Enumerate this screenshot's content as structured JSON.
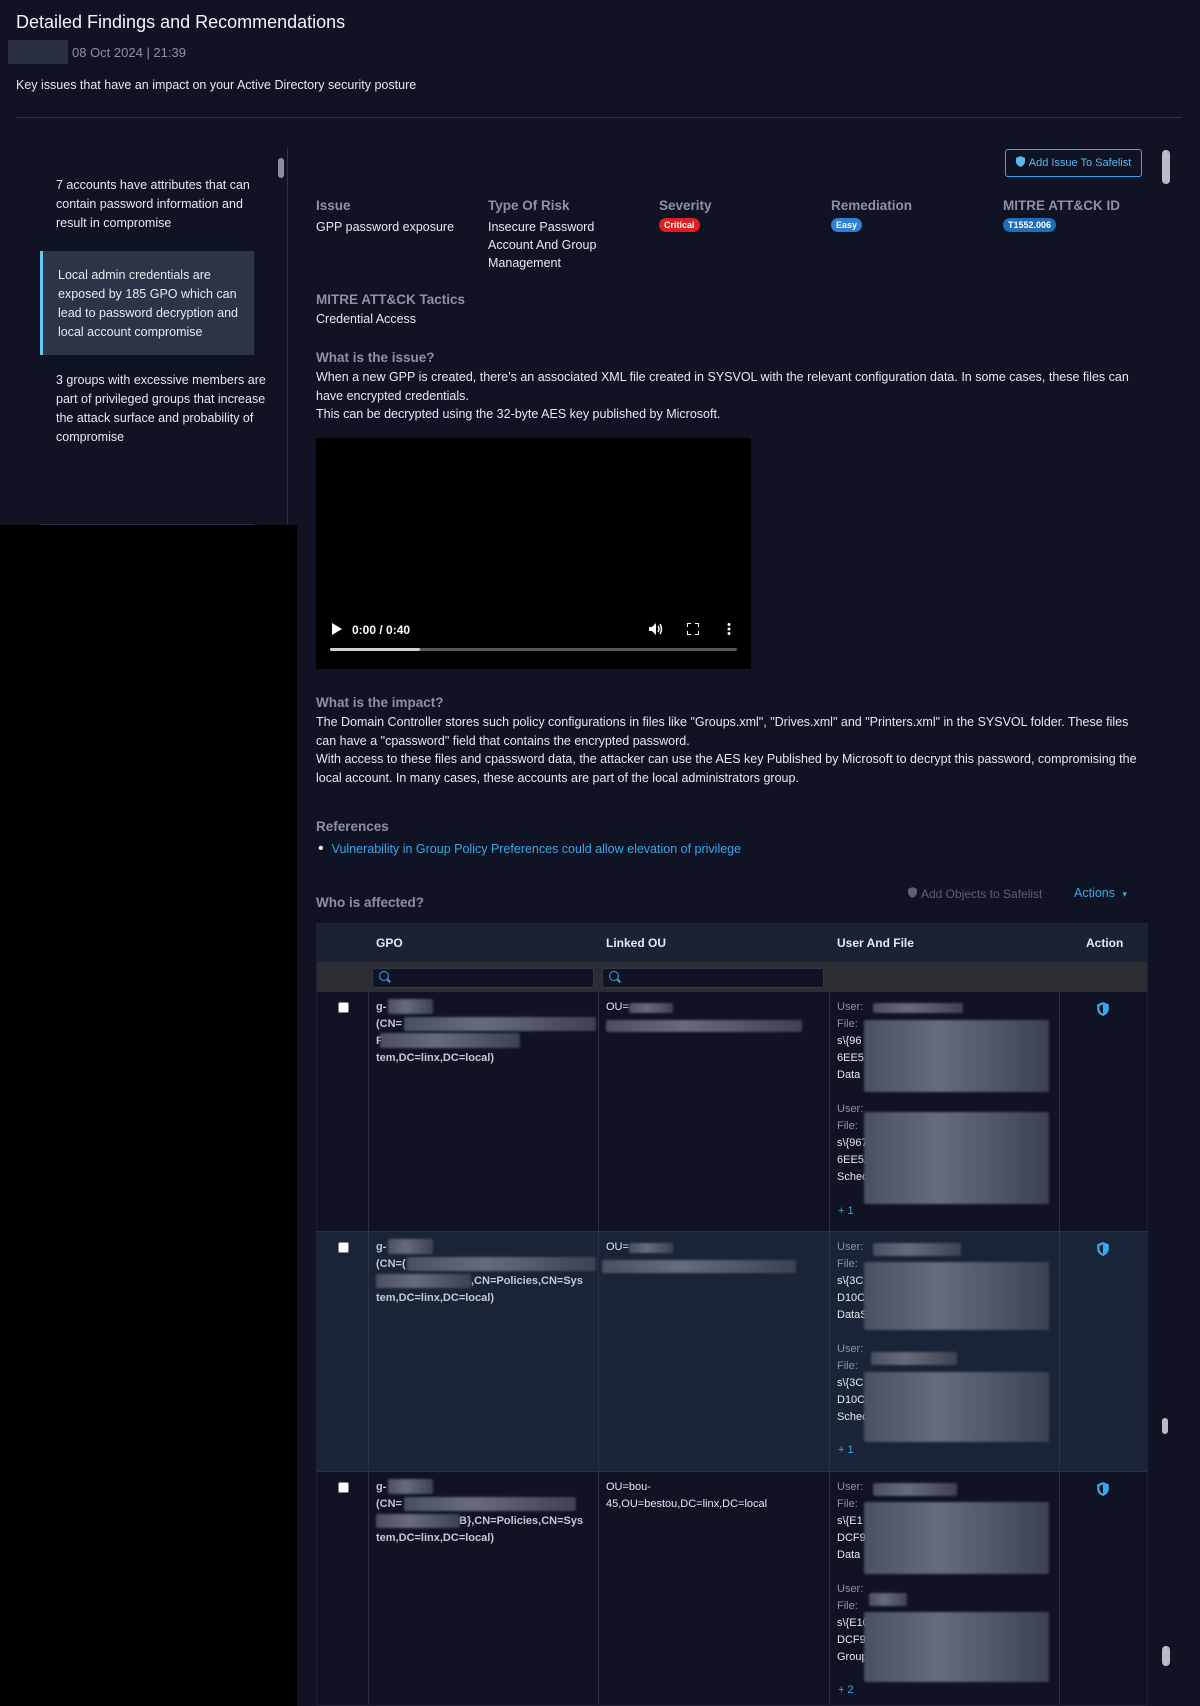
{
  "header": {
    "title": "Detailed Findings and Recommendations",
    "timestamp": "08 Oct 2024 | 21:39",
    "subtitle": "Key issues that have an impact on your Active Directory security posture"
  },
  "sidebar": {
    "items": [
      {
        "label": "7 accounts have attributes that can contain password information and result in compromise",
        "active": false
      },
      {
        "label": "Local admin credentials are exposed by 185 GPO which can lead to password decryption and local account compromise",
        "active": true
      },
      {
        "label": "3 groups with excessive members are part of privileged groups that increase the attack surface and probability of compromise",
        "active": false
      }
    ]
  },
  "add_issue_button": "Add Issue To Safelist",
  "issue": {
    "issue_label": "Issue",
    "issue_value": "GPP password exposure",
    "risk_label": "Type Of Risk",
    "risk_value": "Insecure Password Account And Group Management",
    "severity_label": "Severity",
    "severity_value": "Critical",
    "remediation_label": "Remediation",
    "remediation_value": "Easy",
    "mitre_id_label": "MITRE ATT&CK ID",
    "mitre_id_value": "T1552.006",
    "tactics_label": "MITRE ATT&CK Tactics",
    "tactics_value": "Credential Access"
  },
  "what_is_issue": {
    "title": "What is the issue?",
    "p1": "When a new GPP is created, there's an associated XML file created in SYSVOL with the relevant configuration data. In some cases, these files can have encrypted credentials.",
    "p2": "This can be decrypted using the 32-byte AES key published by Microsoft."
  },
  "video": {
    "time": "0:00 / 0:40",
    "progress": 0.22
  },
  "what_is_impact": {
    "title": "What is the impact?",
    "p1": "The Domain Controller stores such policy configurations in files like \"Groups.xml\", \"Drives.xml\" and \"Printers.xml\" in the SYSVOL folder. These files can have a \"cpassword\" field that contains the encrypted password.",
    "p2": "With access to these files and cpassword data, the attacker can use the AES key Published by Microsoft to decrypt this password, compromising the local account. In many cases, these accounts are part of the local administrators group."
  },
  "references": {
    "title": "References",
    "links": [
      "Vulnerability in Group Policy Preferences could allow elevation of privilege"
    ]
  },
  "affected": {
    "title": "Who is affected?",
    "add_objects": "Add Objects to Safelist",
    "actions": "Actions",
    "columns": {
      "gpo": "GPO",
      "linked_ou": "Linked OU",
      "user_file": "User And File",
      "action": "Action"
    },
    "rows": [
      {
        "gpo_line1": "g-",
        "gpo_line2": "(CN=",
        "gpo_line3": "F},CN=Policies,CN=Sys",
        "gpo_line4": "tem,DC=linx,DC=local)",
        "ou": "OU=",
        "ou2": "",
        "u1_user": "User:",
        "u1_file": "File:",
        "u1_f1": "s\\{96",
        "u1_f2": "6EE5",
        "u1_f3": "Data",
        "u2_user": "User:",
        "u2_file": "File:",
        "u2_f1": "s\\{967",
        "u2_f2": "6EE52",
        "u2_f3": "Schec",
        "more": "+ 1"
      },
      {
        "gpo_line1": "g-",
        "gpo_line2": "(CN=(",
        "gpo_line3": ",CN=Policies,CN=Sys",
        "gpo_line4": "tem,DC=linx,DC=local)",
        "ou": "OU=",
        "ou2": "",
        "u1_user": "User:",
        "u1_file": "File:",
        "u1_f1": "s\\{3C",
        "u1_f2": "D10C",
        "u1_f3": "DataS",
        "u2_user": "User:",
        "u2_file": "File:",
        "u2_f1": "s\\{3C",
        "u2_f2": "D10C",
        "u2_f3": "Schec",
        "more": "+ 1"
      },
      {
        "gpo_line1": "g-",
        "gpo_line2": "(CN=",
        "gpo_line3": "B},CN=Policies,CN=Sys",
        "gpo_line4": "tem,DC=linx,DC=local)",
        "ou": "OU=bou-",
        "ou2": "45,OU=bestou,DC=linx,DC=local",
        "u1_user": "User:",
        "u1_file": "File:",
        "u1_f1": "s\\{E1",
        "u1_f2": "DCF9",
        "u1_f3": "Data",
        "u2_user": "User:",
        "u2_file": "File:",
        "u2_f1": "s\\{E10",
        "u2_f2": "DCF9",
        "u2_f3": "Group",
        "more": "+ 2"
      }
    ]
  },
  "colors": {
    "accent": "#3aa7e6",
    "critical": "#e02020",
    "easy": "#2e7fd8",
    "mitre": "#1f6fb8"
  }
}
